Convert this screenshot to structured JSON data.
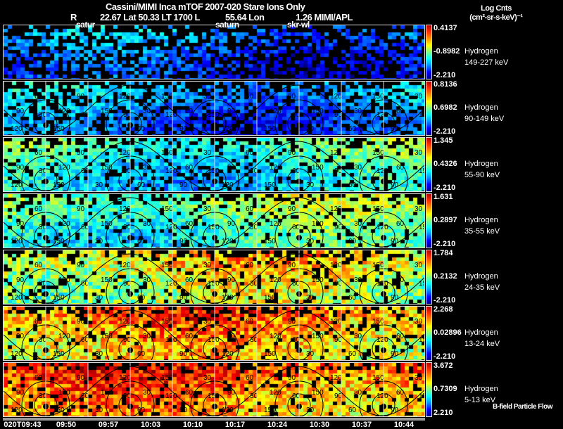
{
  "header": {
    "title": "Cassini/MIMI Inca mTOF  2007-020   Stare   Ions Only",
    "r_label": "R",
    "r_lat_lt": "22.67 Lat 50.33 LT 1700 L",
    "lon": "55.64 Lon",
    "tail": "1.26  MIMI/APL"
  },
  "units": {
    "line1": "Log Cnts",
    "line2": "(cm²-sr-s-keV)⁻¹"
  },
  "overlay_labels": [
    "satur",
    "saturn",
    "skr-wl"
  ],
  "footer_label": "B-field Particle Flow",
  "chart_data": [
    {
      "type": "heatmap",
      "species": "Hydrogen",
      "energy": "149-227 keV",
      "colorbar": {
        "max": "0.4137",
        "mid": "-0.8982",
        "min": "-2.210"
      }
    },
    {
      "type": "heatmap",
      "species": "Hydrogen",
      "energy": "90-149 keV",
      "colorbar": {
        "max": "0.8136",
        "mid": "0.6982",
        "min": "-2.210"
      }
    },
    {
      "type": "heatmap",
      "species": "Hydrogen",
      "energy": "55-90 keV",
      "colorbar": {
        "max": "1.345",
        "mid": "0.4326",
        "min": "-2.210"
      }
    },
    {
      "type": "heatmap",
      "species": "Hydrogen",
      "energy": "35-55 keV",
      "colorbar": {
        "max": "1.631",
        "mid": "0.2897",
        "min": "-2.210"
      }
    },
    {
      "type": "heatmap",
      "species": "Hydrogen",
      "energy": "24-35 keV",
      "colorbar": {
        "max": "1.784",
        "mid": "0.2132",
        "min": "-2.210"
      }
    },
    {
      "type": "heatmap",
      "species": "Hydrogen",
      "energy": "13-24 keV",
      "colorbar": {
        "max": "2.268",
        "mid": "0.02896",
        "min": "-2.210"
      }
    },
    {
      "type": "heatmap",
      "species": "Hydrogen",
      "energy": "5-13 keV",
      "colorbar": {
        "max": "3.672",
        "mid": "0.7309",
        "min": "2.210"
      }
    }
  ],
  "time_axis": [
    "020T09:43",
    "09:50",
    "09:57",
    "10:03",
    "10:10",
    "10:17",
    "10:24",
    "10:30",
    "10:37",
    "10:44"
  ],
  "contour_labels": [
    "30",
    "60",
    "90",
    "120",
    "150"
  ],
  "colormap": "jet"
}
